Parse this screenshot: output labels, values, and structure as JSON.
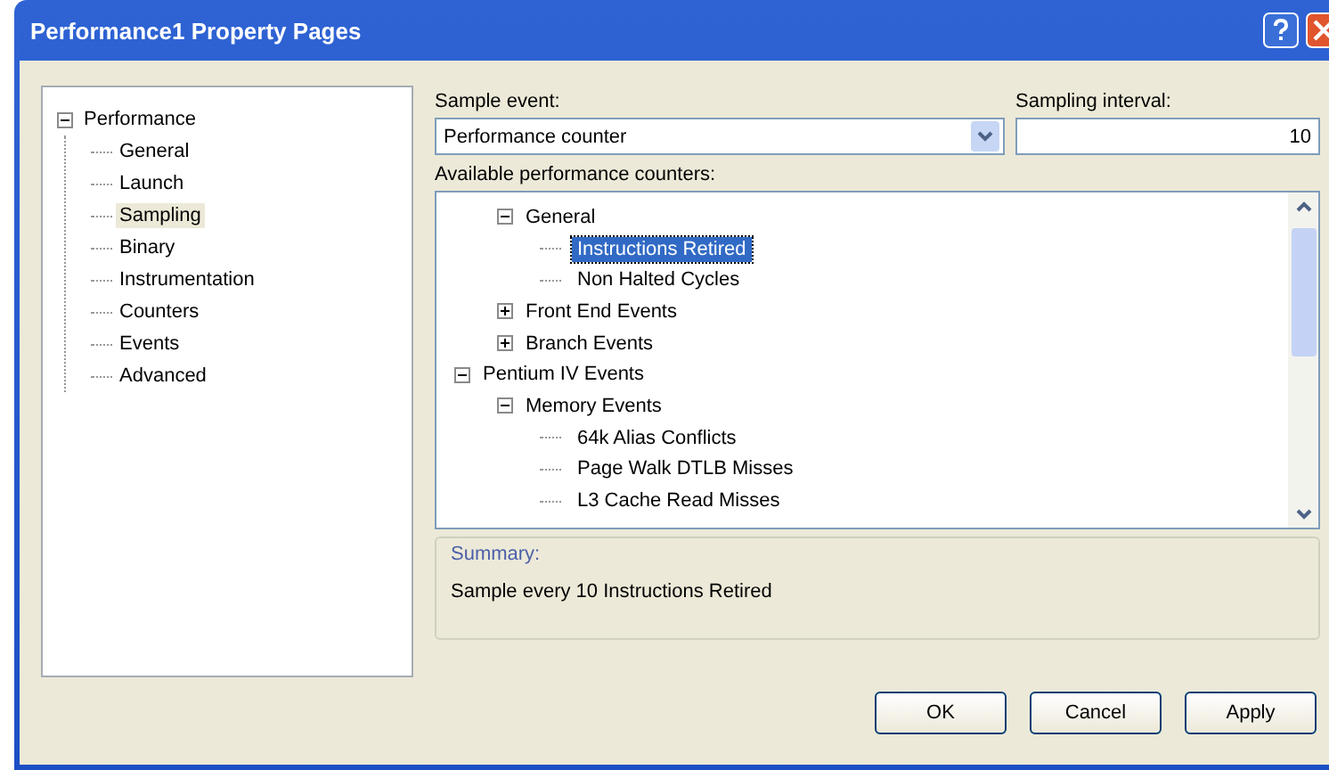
{
  "window": {
    "title": "Performance1 Property Pages"
  },
  "nav_tree": {
    "label": "Performance",
    "expanded": true,
    "children": [
      {
        "label": "General",
        "selected": false
      },
      {
        "label": "Launch",
        "selected": false
      },
      {
        "label": "Sampling",
        "selected": true
      },
      {
        "label": "Binary",
        "selected": false
      },
      {
        "label": "Instrumentation",
        "selected": false
      },
      {
        "label": "Counters",
        "selected": false
      },
      {
        "label": "Events",
        "selected": false
      },
      {
        "label": "Advanced",
        "selected": false
      }
    ]
  },
  "sample_event": {
    "label": "Sample event:",
    "value": "Performance counter"
  },
  "sampling_interval": {
    "label": "Sampling interval:",
    "value": "10"
  },
  "counters": {
    "label": "Available performance counters:",
    "tree": [
      {
        "children": [
          {
            "label": "General",
            "expanded": true,
            "selected": false,
            "children": [
              {
                "label": "Instructions Retired",
                "selected": true
              },
              {
                "label": "Non Halted Cycles",
                "selected": false
              }
            ]
          },
          {
            "label": "Front End Events",
            "expanded": false,
            "selected": false
          },
          {
            "label": "Branch Events",
            "expanded": false,
            "selected": false
          }
        ]
      },
      {
        "label": "Pentium IV Events",
        "expanded": true,
        "selected": false,
        "children": [
          {
            "label": "Memory Events",
            "expanded": true,
            "selected": false,
            "children": [
              {
                "label": "64k Alias Conflicts",
                "selected": false
              },
              {
                "label": "Page Walk DTLB Misses",
                "selected": false
              },
              {
                "label": "L3 Cache Read Misses",
                "selected": false
              }
            ]
          }
        ]
      }
    ]
  },
  "summary": {
    "label": "Summary:",
    "text": "Sample every 10 Instructions Retired"
  },
  "buttons": [
    "OK",
    "Cancel",
    "Apply"
  ]
}
